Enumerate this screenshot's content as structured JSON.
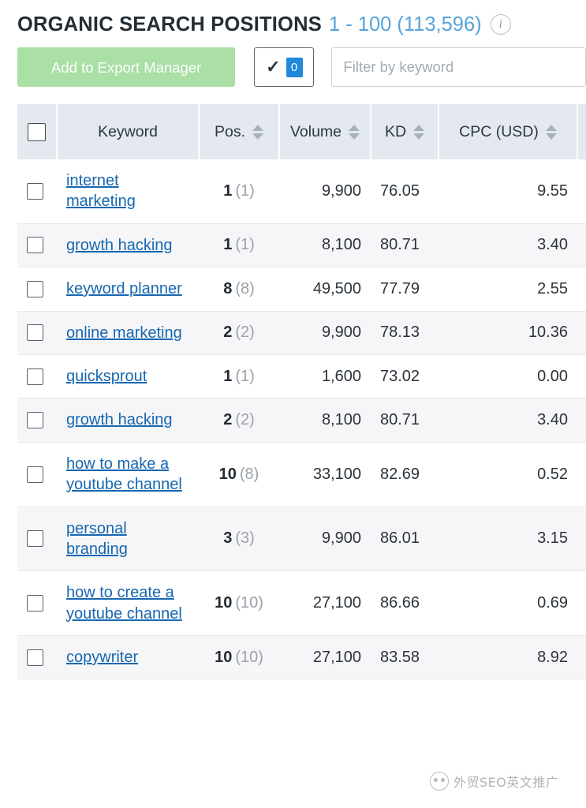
{
  "header": {
    "title": "ORGANIC SEARCH POSITIONS",
    "range": "1 - 100 (113,596)",
    "info_icon": "info-icon",
    "info_glyph": "i"
  },
  "toolbar": {
    "export_label": "Add to Export Manager",
    "selected_check_glyph": "✓",
    "selected_count": "0",
    "filter_placeholder": "Filter by keyword",
    "filter_value": ""
  },
  "table": {
    "columns": [
      {
        "key": "check",
        "label": "",
        "sortable": false
      },
      {
        "key": "keyword",
        "label": "Keyword",
        "sortable": false
      },
      {
        "key": "pos",
        "label": "Pos.",
        "sortable": true
      },
      {
        "key": "volume",
        "label": "Volume",
        "sortable": true
      },
      {
        "key": "kd",
        "label": "KD",
        "sortable": true
      },
      {
        "key": "cpc",
        "label": "CPC (USD)",
        "sortable": true
      }
    ],
    "rows": [
      {
        "keyword": "internet marketing",
        "pos": "1",
        "pos_prev": "(1)",
        "volume": "9,900",
        "kd": "76.05",
        "cpc": "9.55"
      },
      {
        "keyword": "growth hacking",
        "pos": "1",
        "pos_prev": "(1)",
        "volume": "8,100",
        "kd": "80.71",
        "cpc": "3.40"
      },
      {
        "keyword": "keyword planner",
        "pos": "8",
        "pos_prev": "(8)",
        "volume": "49,500",
        "kd": "77.79",
        "cpc": "2.55"
      },
      {
        "keyword": "online marketing",
        "pos": "2",
        "pos_prev": "(2)",
        "volume": "9,900",
        "kd": "78.13",
        "cpc": "10.36"
      },
      {
        "keyword": "quicksprout",
        "pos": "1",
        "pos_prev": "(1)",
        "volume": "1,600",
        "kd": "73.02",
        "cpc": "0.00"
      },
      {
        "keyword": "growth hacking",
        "pos": "2",
        "pos_prev": "(2)",
        "volume": "8,100",
        "kd": "80.71",
        "cpc": "3.40"
      },
      {
        "keyword": "how to make a youtube channel",
        "pos": "10",
        "pos_prev": "(8)",
        "volume": "33,100",
        "kd": "82.69",
        "cpc": "0.52"
      },
      {
        "keyword": "personal branding",
        "pos": "3",
        "pos_prev": "(3)",
        "volume": "9,900",
        "kd": "86.01",
        "cpc": "3.15"
      },
      {
        "keyword": "how to create a youtube channel",
        "pos": "10",
        "pos_prev": "(10)",
        "volume": "27,100",
        "kd": "86.66",
        "cpc": "0.69"
      },
      {
        "keyword": "copywriter",
        "pos": "10",
        "pos_prev": "(10)",
        "volume": "27,100",
        "kd": "83.58",
        "cpc": "8.92"
      }
    ]
  },
  "watermark": {
    "text": "外贸SEO英文推广"
  },
  "colors": {
    "link": "#1767b0",
    "accent_blue": "#55a4d8",
    "badge_blue": "#2288d9",
    "button_green": "#aadfa5",
    "header_bg": "#e3e9ef",
    "stripe_bg": "#f6f6f8"
  }
}
